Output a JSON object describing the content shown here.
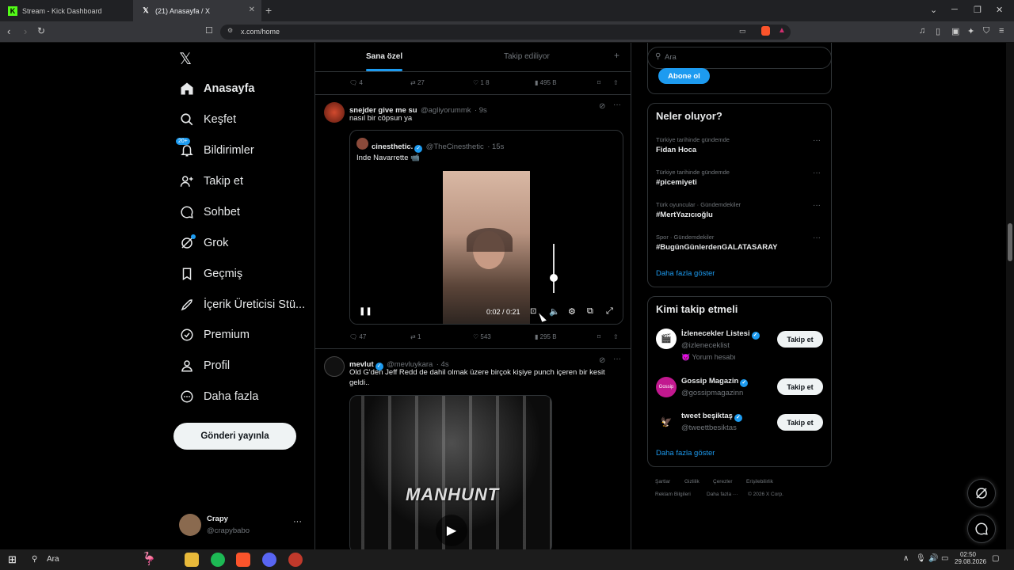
{
  "browser": {
    "tabs": [
      {
        "title": "Stream - Kick Dashboard"
      },
      {
        "title": "(21) Anasayfa / X"
      }
    ],
    "url": "x.com/home"
  },
  "nav": {
    "items": [
      {
        "label": "Anasayfa"
      },
      {
        "label": "Keşfet"
      },
      {
        "label": "Bildirimler",
        "badge": "20+"
      },
      {
        "label": "Takip et"
      },
      {
        "label": "Sohbet"
      },
      {
        "label": "Grok"
      },
      {
        "label": "Geçmiş"
      },
      {
        "label": "İçerik Üreticisi Stü..."
      },
      {
        "label": "Premium"
      },
      {
        "label": "Profil"
      },
      {
        "label": "Daha fazla"
      }
    ],
    "post_button": "Gönderi yayınla",
    "account": {
      "name": "Crapy",
      "handle": "@crapybabo"
    }
  },
  "feed": {
    "tabs": [
      "Sana özel",
      "Takip ediliyor"
    ],
    "top_actions": {
      "replies": "4",
      "reposts": "27",
      "likes": "1 8",
      "views": "495 B"
    },
    "post1": {
      "name": "snejder give me su",
      "handle": "@agliyorummk",
      "time": "· 9s",
      "text": "nasıl bir cöpsun ya",
      "quote": {
        "name": "cinesthetic.",
        "handle": "@TheCinesthetic",
        "time": "· 15s",
        "text": "Inde Navarrette 📹",
        "video_time": "0:02 / 0:21"
      },
      "actions": {
        "replies": "47",
        "reposts": "1",
        "likes": "543",
        "views": "295 B"
      }
    },
    "post2": {
      "name": "mevlut",
      "handle": "@mevluykara",
      "time": "· 4s",
      "text": "Old G'den Jeff Redd de dahil olmak üzere birçok kişiye punch içeren bir kesit geldi..",
      "video_overlay": "MANHUNT"
    }
  },
  "right": {
    "search_placeholder": "Ara",
    "subscribe_label": "Abone ol",
    "trends_title": "Neler oluyor?",
    "trends": [
      {
        "meta": "Türkiye tarihinde gündemde",
        "name": "Fidan Hoca"
      },
      {
        "meta": "Türkiye tarihinde gündemde",
        "name": "#picemiyeti"
      },
      {
        "meta": "Türk oyuncular · Gündemdekiler",
        "name": "#MertYazıcıoğlu"
      },
      {
        "meta": "Spor · Gündemdekiler",
        "name": "#BugünGünlerdenGALATASARAY"
      }
    ],
    "trends_more": "Daha fazla göster",
    "who_title": "Kimi takip etmeli",
    "who": [
      {
        "name": "İzlenecekler Listesi",
        "handle": "@izleneceklist",
        "note": "😈 Yorum hesabı",
        "button": "Takip et"
      },
      {
        "name": "Gossip Magazin",
        "handle": "@gossipmagazinn",
        "button": "Takip et"
      },
      {
        "name": "tweet beşiktaş",
        "handle": "@tweettbesiktas",
        "button": "Takip et"
      }
    ],
    "who_more": "Daha fazla göster",
    "footer": [
      "Şartlar",
      "Gizlilik",
      "Çerezler",
      "Erişilebilirlik",
      "Reklam Bilgileri",
      "Daha fazla ···",
      "© 2026 X Corp."
    ]
  },
  "taskbar": {
    "search": "Ara",
    "time": "02:50",
    "date": "29.08.2026"
  }
}
